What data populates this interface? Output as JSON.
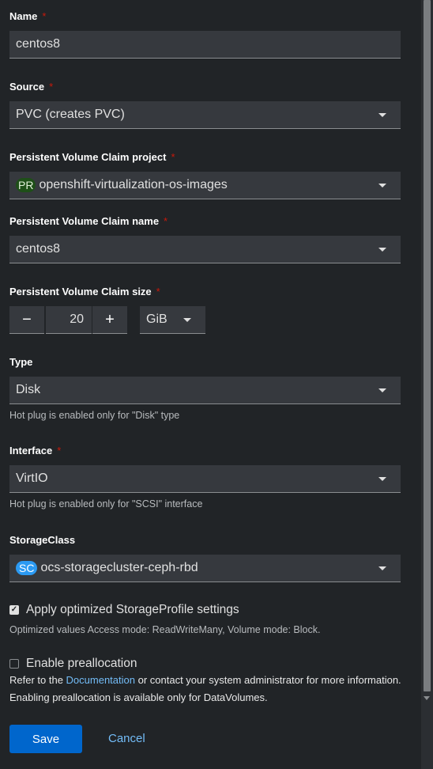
{
  "form": {
    "name": {
      "label": "Name",
      "value": "centos8"
    },
    "source": {
      "label": "Source",
      "value": "PVC (creates PVC)"
    },
    "pvc_project": {
      "label": "Persistent Volume Claim project",
      "badge": "PR",
      "value": "openshift-virtualization-os-images"
    },
    "pvc_name": {
      "label": "Persistent Volume Claim name",
      "value": "centos8"
    },
    "pvc_size": {
      "label": "Persistent Volume Claim size",
      "minus": "−",
      "value": "20",
      "plus": "+",
      "unit": "GiB"
    },
    "type": {
      "label": "Type",
      "value": "Disk",
      "helper": "Hot plug is enabled only for \"Disk\" type"
    },
    "interface": {
      "label": "Interface",
      "value": "VirtIO",
      "helper": "Hot plug is enabled only for \"SCSI\" interface"
    },
    "storage_class": {
      "label": "StorageClass",
      "badge": "SC",
      "value": "ocs-storagecluster-ceph-rbd"
    },
    "optimized": {
      "label": "Apply optimized StorageProfile settings",
      "checked": true,
      "helper": "Optimized values Access mode: ReadWriteMany, Volume mode: Block."
    },
    "preallocation": {
      "label": "Enable preallocation",
      "checked": false,
      "text_before": "Refer to the ",
      "link": "Documentation",
      "text_after": " or contact your system administrator for more information. Enabling preallocation is available only for DataVolumes."
    },
    "required_mark": "*"
  },
  "actions": {
    "save": "Save",
    "cancel": "Cancel"
  },
  "colors": {
    "background": "#212427",
    "field": "#36393e",
    "primary": "#0066cc",
    "link": "#73bcf7",
    "required": "#c9190b"
  }
}
